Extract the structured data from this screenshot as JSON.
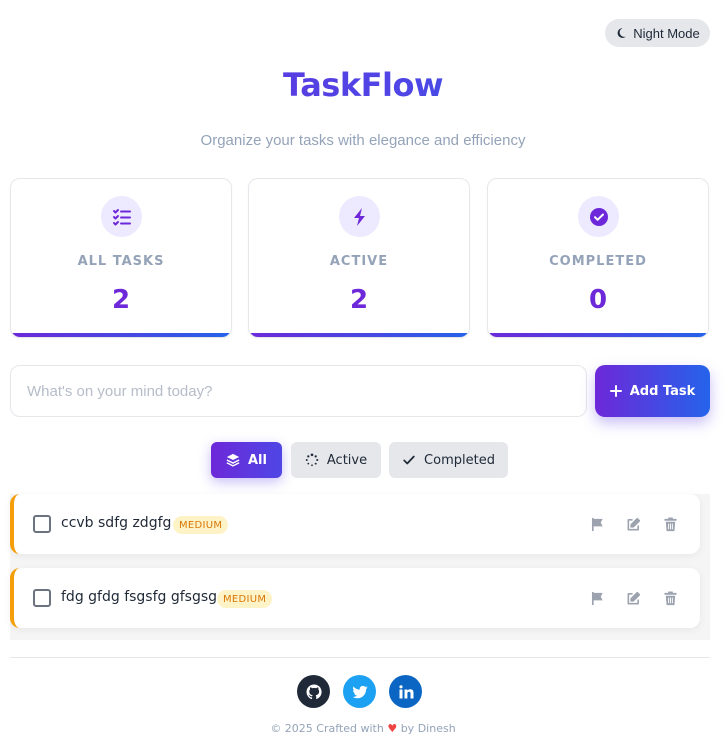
{
  "header": {
    "night_mode_label": "Night Mode",
    "title": "TaskFlow",
    "subtitle": "Organize your tasks with elegance and efficiency"
  },
  "stats": [
    {
      "label": "ALL TASKS",
      "value": "2",
      "icon": "list-check-icon"
    },
    {
      "label": "ACTIVE",
      "value": "2",
      "icon": "bolt-icon"
    },
    {
      "label": "COMPLETED",
      "value": "0",
      "icon": "check-circle-icon"
    }
  ],
  "input": {
    "placeholder": "What's on your mind today?",
    "value": ""
  },
  "add_button_label": "Add Task",
  "filters": [
    {
      "label": "All",
      "icon": "layers-icon",
      "selected": true
    },
    {
      "label": "Active",
      "icon": "spinner-icon",
      "selected": false
    },
    {
      "label": "Completed",
      "icon": "check-icon",
      "selected": false
    }
  ],
  "tasks": [
    {
      "text": "ccvb sdfg zdgfg",
      "priority": "MEDIUM",
      "done": false
    },
    {
      "text": "fdg gfdg fsgsfg gfsgsg",
      "priority": "MEDIUM",
      "done": false
    }
  ],
  "footer": {
    "prefix": "© 2025 Crafted with",
    "suffix": "by Dinesh",
    "socials": [
      "github-icon",
      "twitter-icon",
      "linkedin-icon"
    ]
  },
  "colors": {
    "primary": "#6d28d9",
    "accent": "#2563eb",
    "priority_medium": "#f59e0b",
    "muted": "#94a3b8"
  }
}
